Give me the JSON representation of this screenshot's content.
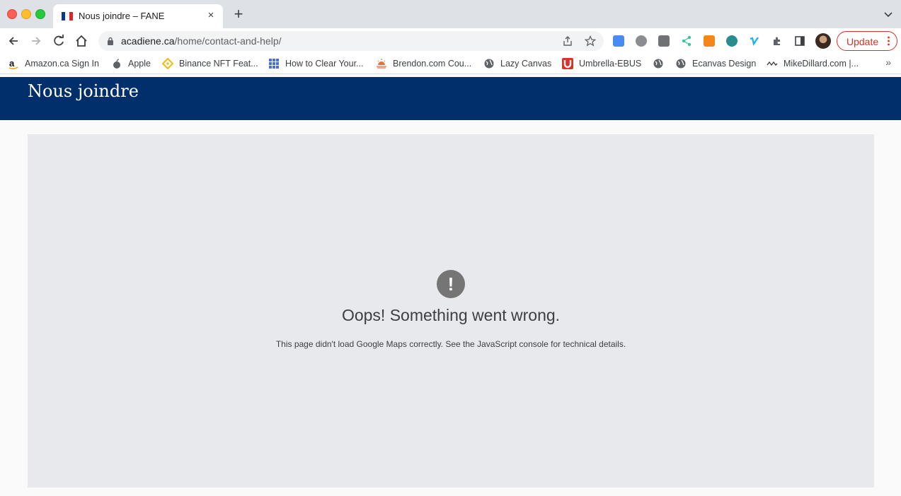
{
  "browser": {
    "tab": {
      "title": "Nous joindre – FANE",
      "close_symbol": "×"
    },
    "new_tab_symbol": "+",
    "address": {
      "domain": "acadiene.ca",
      "path": "/home/contact-and-help/"
    },
    "update_label": "Update",
    "bookmarks": [
      {
        "label": "Amazon.ca Sign In",
        "icon": "amazon-icon"
      },
      {
        "label": "Apple",
        "icon": "apple-icon"
      },
      {
        "label": "Binance NFT Feat...",
        "icon": "binance-icon"
      },
      {
        "label": "How to Clear Your...",
        "icon": "grid-icon"
      },
      {
        "label": "Brendon.com Cou...",
        "icon": "sunrise-icon"
      },
      {
        "label": "Lazy Canvas",
        "icon": "globe-icon"
      },
      {
        "label": "Umbrella-EBUS",
        "icon": "umbrella-icon"
      },
      {
        "label": "",
        "icon": "globe-icon"
      },
      {
        "label": "Ecanvas Design",
        "icon": "globe-icon"
      },
      {
        "label": "MikeDillard.com |...",
        "icon": "md-icon"
      }
    ],
    "bookmarks_more_symbol": "»"
  },
  "page": {
    "header_title": "Nous joindre",
    "map_error": {
      "icon_mark": "!",
      "title": "Oops! Something went wrong.",
      "detail": "This page didn't load Google Maps correctly. See the JavaScript console for technical details."
    }
  },
  "colors": {
    "header_bg": "#002f6c",
    "map_bg": "#e8e9ec",
    "update_red": "#d93025",
    "tabstrip_bg": "#dee1e6"
  }
}
